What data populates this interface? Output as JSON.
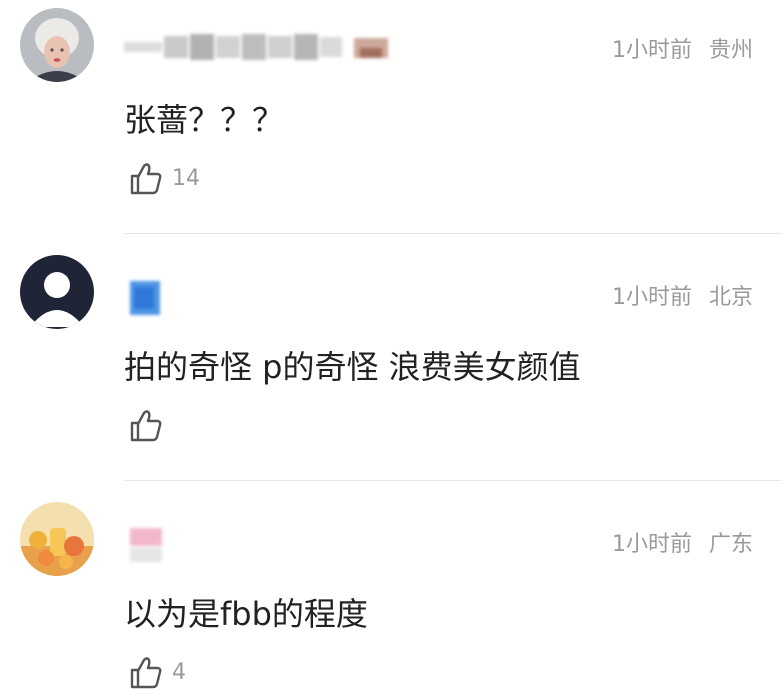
{
  "comments": [
    {
      "text": "张蔷？？？",
      "time": "1小时前",
      "location": "贵州",
      "likes": "14"
    },
    {
      "text": "拍的奇怪 p的奇怪 浪费美女颜值",
      "time": "1小时前",
      "location": "北京",
      "likes": ""
    },
    {
      "text": "以为是fbb的程度",
      "time": "1小时前",
      "location": "广东",
      "likes": "4"
    }
  ]
}
